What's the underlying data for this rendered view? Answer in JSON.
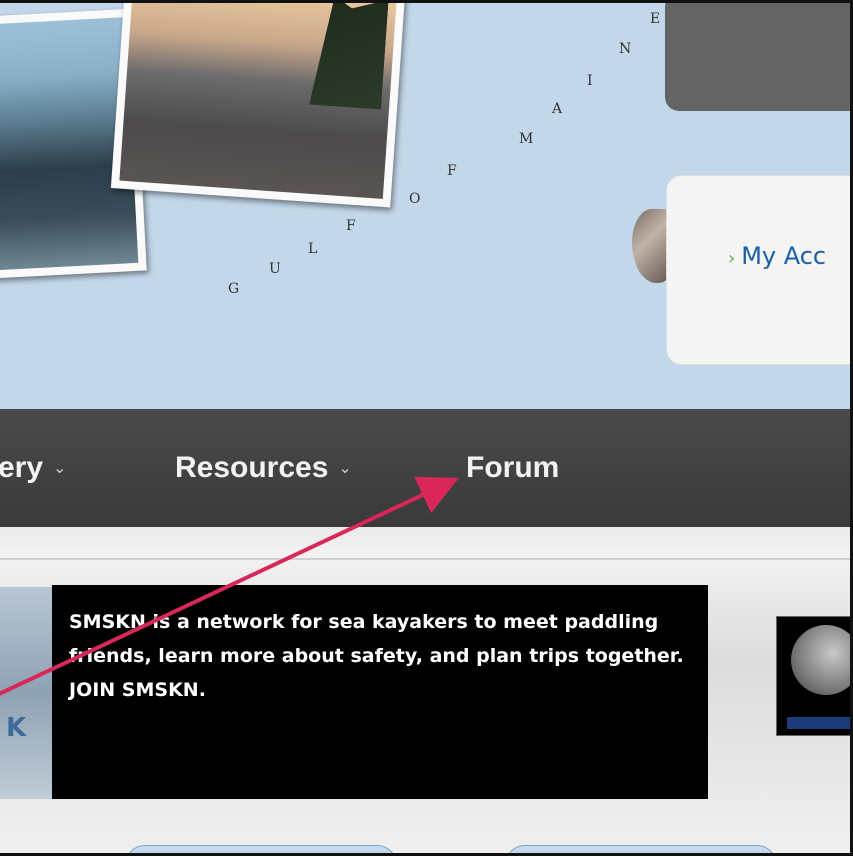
{
  "header": {
    "gulf_letters": [
      "G",
      "U",
      "L",
      "F",
      "O",
      "F",
      "M",
      "A",
      "I",
      "N",
      "E"
    ],
    "account_link": "My Acc",
    "account_chevron": "›"
  },
  "nav": {
    "items": [
      {
        "label": "ery",
        "dropdown": true
      },
      {
        "label": "Resources",
        "dropdown": true
      },
      {
        "label": "Forum",
        "dropdown": false
      }
    ],
    "caret": "⌄"
  },
  "content": {
    "blurb": "SMSKN is a network for sea kayakers to meet paddling friends, learn more about safety, and plan trips together. JOIN SMSKN.",
    "left_marker": "K"
  },
  "colors": {
    "map_background": "#c3d7ea",
    "nav_background": "#3f3f3f",
    "link": "#1a5ea8",
    "arrow": "#d9275a"
  }
}
